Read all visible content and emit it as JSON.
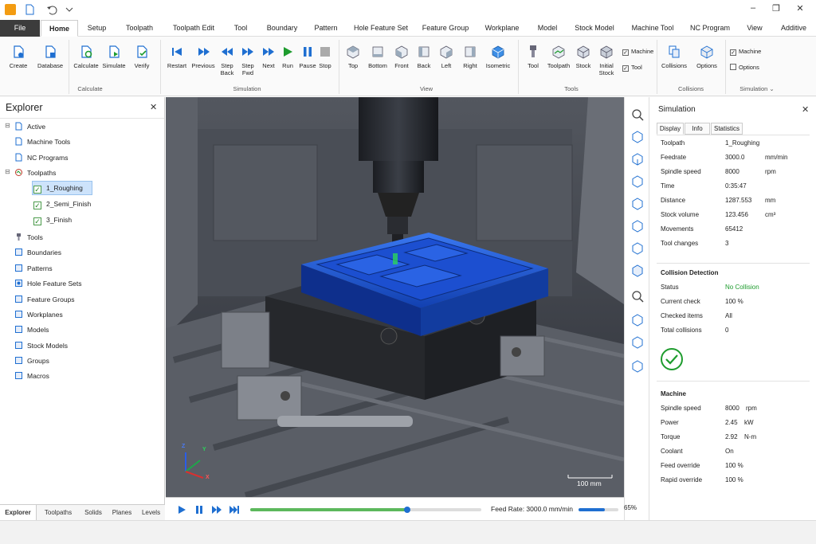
{
  "tabs": {
    "file": "File",
    "home": "Home",
    "setup": "Setup",
    "toolpath": "Toolpath",
    "toolpath_edit": "Toolpath Edit",
    "tool": "Tool",
    "boundary": "Boundary",
    "pattern": "Pattern",
    "hole_feature_set": "Hole Feature Set",
    "feature_group": "Feature Group",
    "workplane": "Workplane",
    "model": "Model",
    "stock_model": "Stock Model",
    "machine_tool": "Machine Tool",
    "nc_program": "NC Program",
    "view": "View",
    "additive": "Additive"
  },
  "ribbon": {
    "create": "Create",
    "database": "Database",
    "calculate": "Calculate",
    "simulate": "Simulate",
    "verify": "Verify",
    "grp_calculate": "Calculate",
    "restart": "Restart",
    "previous": "Previous",
    "step_back": "Step\nBack",
    "step_fwd": "Step\nFwd",
    "next": "Next",
    "run": "Run",
    "pause": "Pause",
    "stop": "Stop",
    "grp_simulation": "Simulation",
    "top": "Top",
    "bottom": "Bottom",
    "front": "Front",
    "back": "Back",
    "left": "Left",
    "right": "Right",
    "isometric": "Isometric",
    "grp_view": "View",
    "tool": "Tool",
    "toolpath": "Toolpath",
    "stock": "Stock",
    "initial_stock": "Initial\nStock",
    "chk_machine": "Machine",
    "chk_tool": "Tool",
    "grp_tools": "Tools",
    "collisions": "Collisions",
    "options": "Options",
    "grp_collisions": "Collisions",
    "chk_machine2": "Machine",
    "chk_options": "Options",
    "grp_simulation2": "Simulation"
  },
  "explorer": {
    "title": "Explorer",
    "items": [
      "Active",
      "Machine Tools",
      "NC Programs",
      "Toolpaths",
      "1_Roughing",
      "2_Semi_Finish",
      "3_Finish",
      "Tools",
      "Boundaries",
      "Patterns",
      "Hole Feature Sets",
      "Feature Groups",
      "Workplanes",
      "Models",
      "Stock Models",
      "Groups",
      "Macros"
    ],
    "bottom_tabs": [
      "Explorer",
      "Toolpaths",
      "Solids",
      "Planes",
      "Levels"
    ]
  },
  "viewport": {
    "scale_label": "100 mm",
    "axis_x": "X",
    "axis_y": "Y",
    "axis_z": "Z"
  },
  "playbar": {
    "feed_rate": "Feed Rate: 3000.0 mm/min",
    "speed_pct": "65%",
    "progress": 0.68,
    "speed_fill": 0.65
  },
  "simulation": {
    "title": "Simulation",
    "tabs": [
      "Display",
      "Info",
      "Statistics"
    ],
    "toolpath_label": "Toolpath",
    "toolpath_val": "1_Roughing",
    "feedrate_label": "Feedrate",
    "feedrate_val": "3000.0",
    "feedrate_unit": "mm/min",
    "spindle_label": "Spindle speed",
    "spindle_val": "8000",
    "spindle_unit": "rpm",
    "time_label": "Time",
    "time_val": "0:35:47",
    "distance_label": "Distance",
    "distance_val": "1287.553",
    "distance_unit": "mm",
    "stockvol_label": "Stock volume",
    "stockvol_val": "123.456",
    "stockvol_unit": "cm³",
    "movements_label": "Movements",
    "movements_val": "65412",
    "toolchanges_label": "Tool changes",
    "toolchanges_val": "3",
    "coll_head": "Collision Detection",
    "status_label": "Status",
    "status_val": "No Collision",
    "curcheck_label": "Current check",
    "curcheck_val": "100 %",
    "checked_label": "Checked items",
    "checked_val": "All",
    "totalcoll_label": "Total collisions",
    "totalcoll_val": "0",
    "machine_head": "Machine",
    "m_spindle_label": "Spindle speed",
    "m_spindle_val": "8000",
    "m_spindle_unit": "rpm",
    "power_label": "Power",
    "power_val": "2.45",
    "power_unit": "kW",
    "torque_label": "Torque",
    "torque_val": "2.92",
    "torque_unit": "N-m",
    "coolant_label": "Coolant",
    "coolant_val": "On",
    "feedov_label": "Feed override",
    "feedov_val": "100 %",
    "rapidov_label": "Rapid override",
    "rapidov_val": "100 %"
  },
  "colors": {
    "accent": "#1f6fd1",
    "success": "#1e9c2e",
    "workpiece": "#1e5bd6"
  }
}
